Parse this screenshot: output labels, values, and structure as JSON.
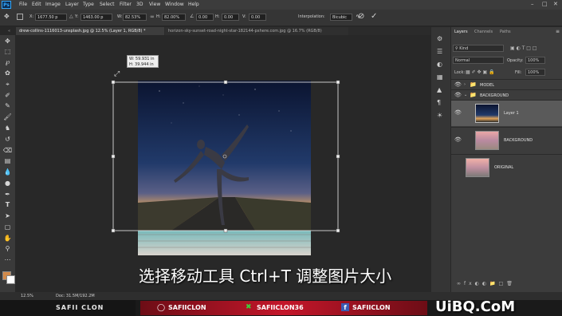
{
  "menubar": {
    "app_icon": "Ps",
    "items": [
      "File",
      "Edit",
      "Image",
      "Layer",
      "Type",
      "Select",
      "Filter",
      "3D",
      "View",
      "Window",
      "Help"
    ]
  },
  "options": {
    "x_label": "X:",
    "x_value": "1677.50 p",
    "y_label": "Y:",
    "y_value": "1463.00 p",
    "w_label": "W:",
    "w_value": "82.53%",
    "h_label": "H:",
    "h_value": "82.00%",
    "angle_value": "0.00",
    "hskew_label": "H:",
    "hskew_value": "0.00",
    "vskew_label": "V:",
    "vskew_value": "0.00",
    "interp_label": "Interpolation:",
    "interp_value": "Bicubic",
    "cancel_icon": "cancel-icon",
    "commit_icon": "check-icon"
  },
  "tabs": [
    {
      "label": "drew-collins-1116013-unsplash.jpg @ 12.5% (Layer 1, RGB/8) *"
    },
    {
      "label": "horizon-sky-sunset-road-night-star-182144-pxhere.com.jpg @ 16.7% (RGB/8)"
    }
  ],
  "transform_readout": {
    "w": "W: 59.931 in",
    "h": "H: 39.944 in"
  },
  "panels": {
    "tabs": [
      "Layers",
      "Channels",
      "Paths"
    ],
    "kind_label": "Kind",
    "blend_mode": "Normal",
    "opacity_label": "Opacity:",
    "opacity_value": "100%",
    "lock_label": "Lock:",
    "fill_label": "Fill:",
    "fill_value": "100%"
  },
  "layers": [
    {
      "name": "MODEL",
      "type": "group"
    },
    {
      "name": "BACKGROUND",
      "type": "group"
    },
    {
      "name": "Layer 1",
      "type": "layer"
    },
    {
      "name": "BACKGROUND",
      "type": "layer"
    },
    {
      "name": "ORIGINAL",
      "type": "layer"
    }
  ],
  "status": {
    "zoom": "12.5%",
    "doc": "Doc: 31.5M/192.2M"
  },
  "subtitle": "选择移动工具 Ctrl+T 调整图片大小",
  "banner": {
    "left_text": "SAFII CLON",
    "instagram": "SAFIICLON",
    "xbox": "SAFIICLON36",
    "facebook": "SAFIICLON"
  },
  "watermark": "UiBQ.CoM"
}
